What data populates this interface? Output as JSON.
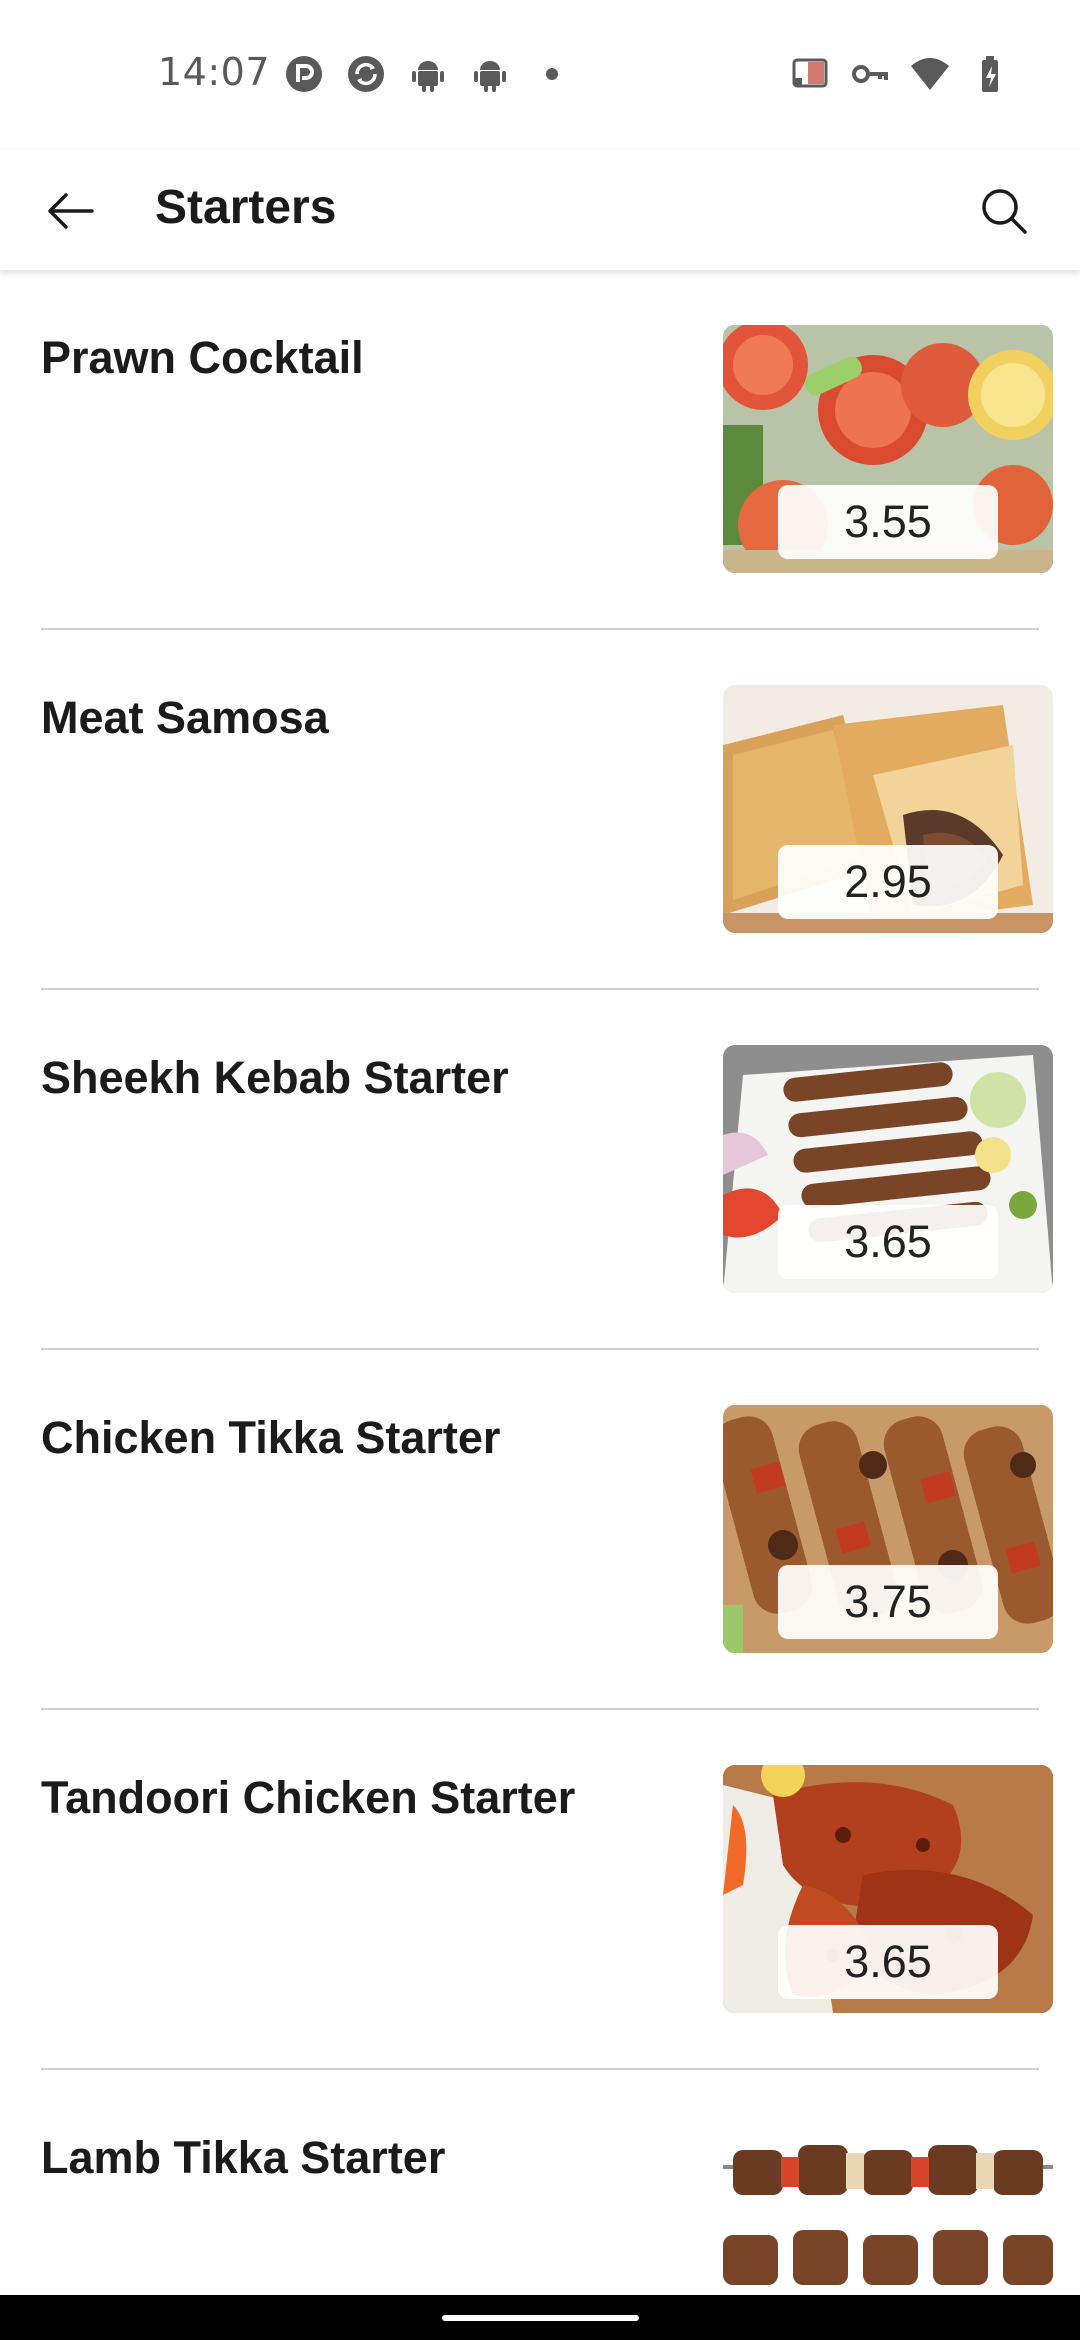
{
  "status_bar": {
    "time": "14:07",
    "left_icons": [
      "pocket-casts-icon",
      "sync-icon",
      "android-icon",
      "android-icon",
      "dot-icon"
    ],
    "right_icons": [
      "cast-icon",
      "vpn-key-icon",
      "wifi-icon",
      "battery-charging-icon"
    ]
  },
  "app_bar": {
    "back_icon": "arrow-left-icon",
    "title": "Starters",
    "search_icon": "search-icon"
  },
  "menu": {
    "items": [
      {
        "name": "Prawn Cocktail",
        "price": "3.55",
        "photo": "salad"
      },
      {
        "name": "Meat Samosa",
        "price": "2.95",
        "photo": "samosa"
      },
      {
        "name": "Sheekh Kebab Starter",
        "price": "3.65",
        "photo": "kebab"
      },
      {
        "name": "Chicken Tikka Starter",
        "price": "3.75",
        "photo": "tikka"
      },
      {
        "name": "Tandoori Chicken Starter",
        "price": "3.65",
        "photo": "tandoori"
      },
      {
        "name": "Lamb Tikka Starter",
        "price": "",
        "photo": "lamb"
      }
    ]
  },
  "colors": {
    "text_primary": "#1b1b1b",
    "divider": "#cfcfcf",
    "background": "#ffffff",
    "nav_bar": "#000000"
  }
}
